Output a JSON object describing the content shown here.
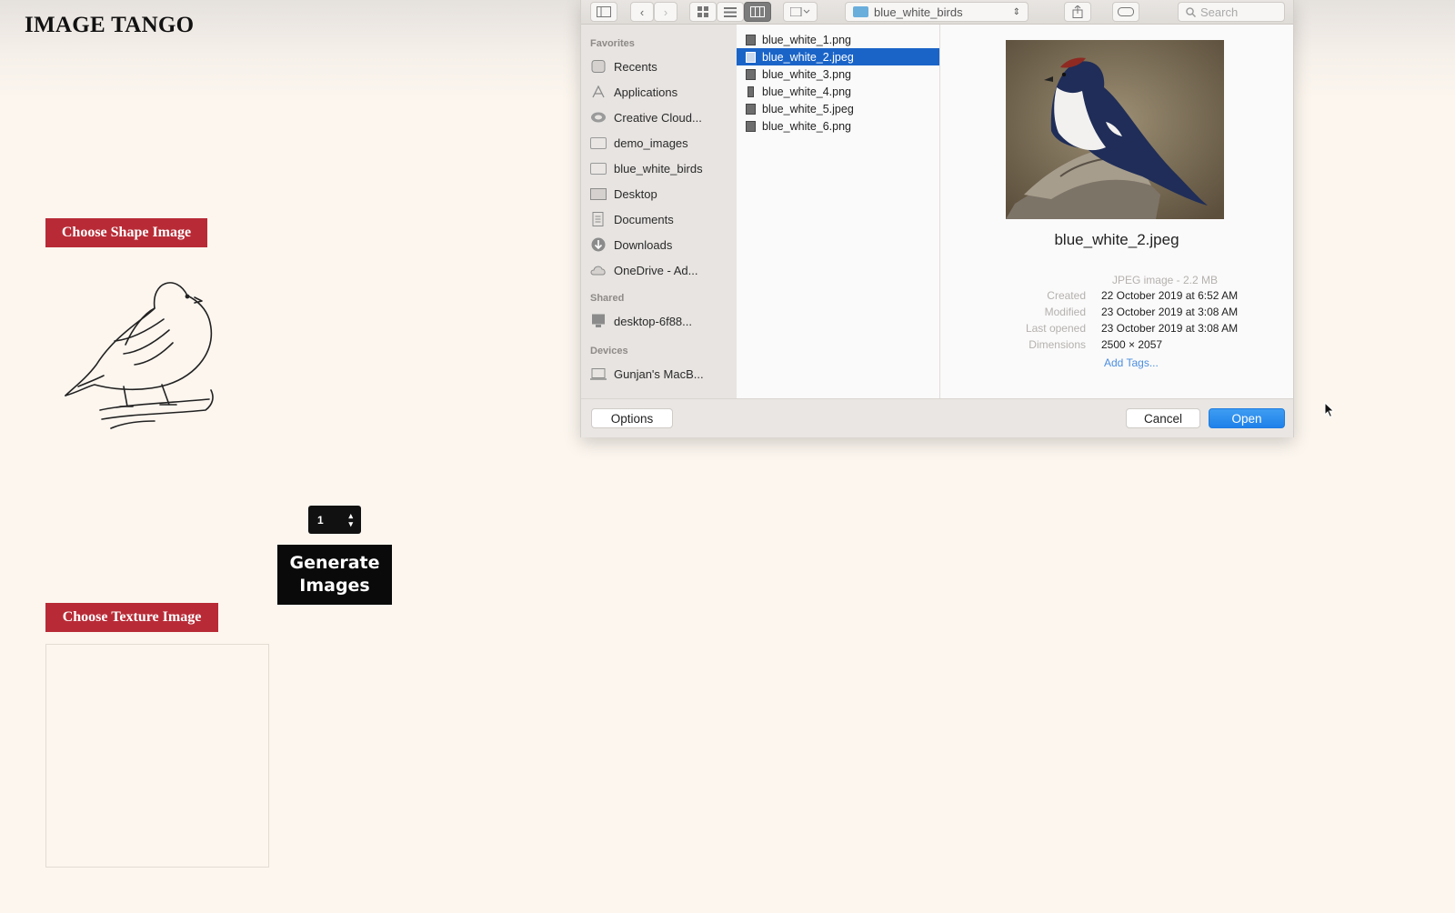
{
  "app": {
    "title": "IMAGE TANGO",
    "shape_button": "Choose Shape Image",
    "texture_button": "Choose Texture Image",
    "count_value": "1",
    "generate_button": "Generate Images"
  },
  "dialog": {
    "current_folder": "blue_white_birds",
    "search_placeholder": "Search",
    "sidebar": {
      "favorites_heading": "Favorites",
      "favorites": [
        {
          "label": "Recents",
          "icon": "clock-icon"
        },
        {
          "label": "Applications",
          "icon": "applications-icon"
        },
        {
          "label": "Creative Cloud...",
          "icon": "creative-cloud-icon"
        },
        {
          "label": "demo_images",
          "icon": "folder-icon"
        },
        {
          "label": "blue_white_birds",
          "icon": "folder-icon"
        },
        {
          "label": "Desktop",
          "icon": "desktop-icon"
        },
        {
          "label": "Documents",
          "icon": "documents-icon"
        },
        {
          "label": "Downloads",
          "icon": "downloads-icon"
        },
        {
          "label": "OneDrive - Ad...",
          "icon": "cloud-icon"
        }
      ],
      "shared_heading": "Shared",
      "shared": [
        {
          "label": "desktop-6f88...",
          "icon": "computer-icon"
        }
      ],
      "devices_heading": "Devices",
      "devices": [
        {
          "label": "Gunjan's MacB...",
          "icon": "laptop-icon"
        }
      ]
    },
    "files": [
      {
        "name": "blue_white_1.png",
        "selected": false
      },
      {
        "name": "blue_white_2.jpeg",
        "selected": true
      },
      {
        "name": "blue_white_3.png",
        "selected": false
      },
      {
        "name": "blue_white_4.png",
        "selected": false
      },
      {
        "name": "blue_white_5.jpeg",
        "selected": false
      },
      {
        "name": "blue_white_6.png",
        "selected": false
      }
    ],
    "preview": {
      "filename": "blue_white_2.jpeg",
      "kind": "JPEG image - 2.2 MB",
      "created_label": "Created",
      "created": "22 October 2019 at 6:52 AM",
      "modified_label": "Modified",
      "modified": "23 October 2019 at 3:08 AM",
      "last_opened_label": "Last opened",
      "last_opened": "23 October 2019 at 3:08 AM",
      "dimensions_label": "Dimensions",
      "dimensions": "2500 × 2057",
      "add_tags": "Add Tags..."
    },
    "options_button": "Options",
    "cancel_button": "Cancel",
    "open_button": "Open"
  },
  "colors": {
    "page_background": "#fcf6ef",
    "red_button": "#b82b36",
    "selection_blue": "#1a64c8",
    "open_blue": "#2a8cee"
  }
}
